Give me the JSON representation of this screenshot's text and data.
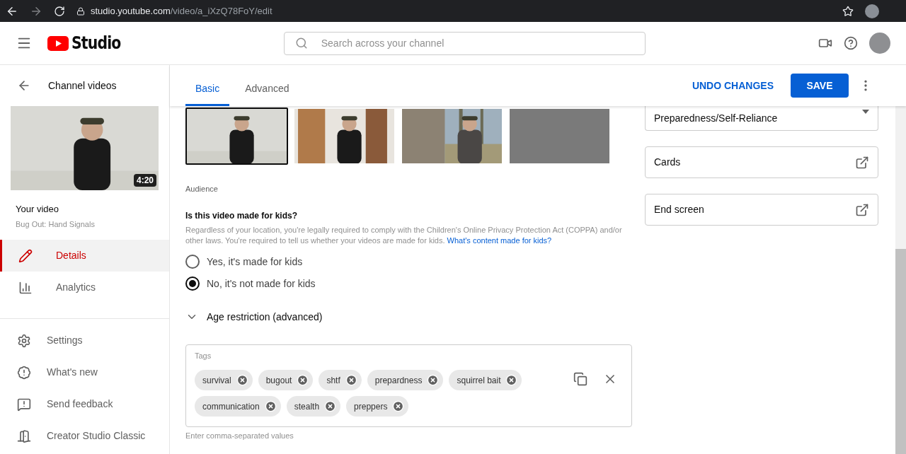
{
  "browser": {
    "url_host": "studio.youtube.com",
    "url_path": "/video/a_iXzQ78FoY/edit"
  },
  "header": {
    "logo_text": "Studio",
    "search": {
      "placeholder": "Search across your channel"
    }
  },
  "sidebar": {
    "back_label": "Channel videos",
    "video": {
      "duration": "4:20",
      "heading": "Your video",
      "title": "Bug Out: Hand Signals"
    },
    "nav": [
      {
        "label": "Details",
        "kind": "pencil",
        "selected": true
      },
      {
        "label": "Analytics",
        "kind": "chart",
        "selected": false
      }
    ],
    "footer": [
      {
        "label": "Settings",
        "kind": "gear"
      },
      {
        "label": "What's new",
        "kind": "badge"
      },
      {
        "label": "Send feedback",
        "kind": "feedback"
      },
      {
        "label": "Creator Studio Classic",
        "kind": "exit"
      }
    ]
  },
  "tabs": [
    {
      "label": "Basic",
      "selected": true
    },
    {
      "label": "Advanced",
      "selected": false
    }
  ],
  "actions": {
    "undo": "UNDO CHANGES",
    "save": "SAVE"
  },
  "thumbnails": [
    {
      "kind": "indoor",
      "selected": true
    },
    {
      "kind": "doorway",
      "selected": false
    },
    {
      "kind": "forest",
      "selected": false
    },
    {
      "kind": "plain",
      "selected": false
    }
  ],
  "audience": {
    "section": "Audience",
    "question": "Is this video made for kids?",
    "description": "Regardless of your location, you're legally required to comply with the Children's Online Privacy Protection Act (COPPA) and/or other laws. You're required to tell us whether your videos are made for kids.",
    "link": "What's content made for kids?",
    "options": [
      {
        "label": "Yes, it's made for kids",
        "selected": false
      },
      {
        "label": "No, it's not made for kids",
        "selected": true
      }
    ]
  },
  "age_restriction": {
    "label": "Age restriction (advanced)",
    "expanded": false
  },
  "tags": {
    "label": "Tags",
    "items": [
      "survival",
      "bugout",
      "shtf",
      "prepardness",
      "squirrel bait",
      "communication",
      "stealth",
      "preppers"
    ],
    "hint": "Enter comma-separated values"
  },
  "right": {
    "playlist_value": "Preparedness/Self-Reliance",
    "links": [
      "Cards",
      "End screen"
    ]
  }
}
